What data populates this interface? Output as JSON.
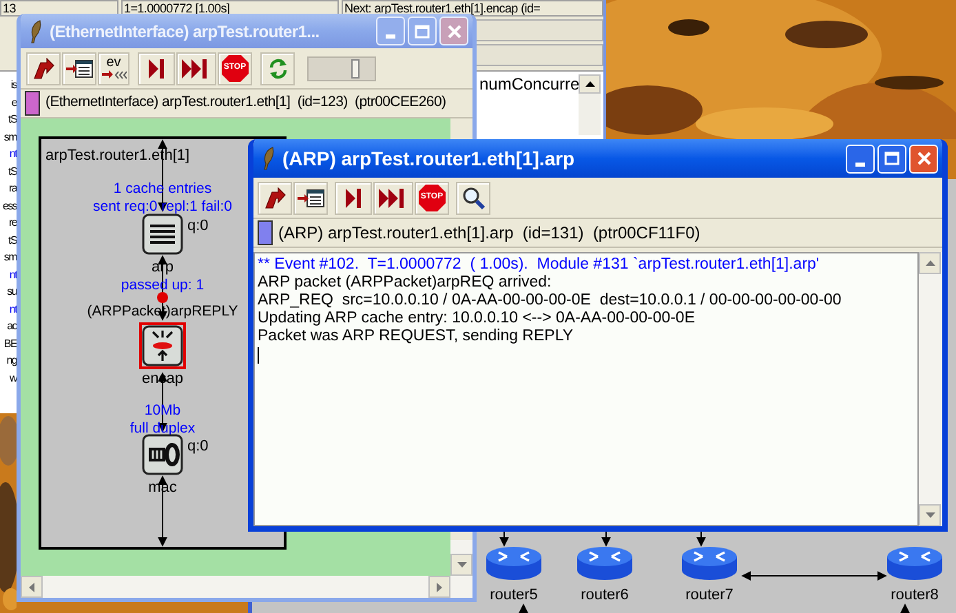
{
  "background_window": {
    "status_fields": [
      "13",
      "1=1.0000772 [1.00s]",
      "Next: arpTest.router1.eth[1].encap (id="
    ],
    "side_fragments": [
      {
        "text": "is",
        "kind": "plain"
      },
      {
        "text": "e",
        "kind": "plain"
      },
      {
        "text": "tS",
        "kind": "plain"
      },
      {
        "text": "sm",
        "kind": "plain"
      },
      {
        "text": "nt",
        "kind": "link"
      },
      {
        "text": "tS",
        "kind": "plain"
      },
      {
        "text": "ra",
        "kind": "plain"
      },
      {
        "text": "ess",
        "kind": "plain"
      },
      {
        "text": "re",
        "kind": "plain"
      },
      {
        "text": "tS",
        "kind": "plain"
      },
      {
        "text": "sm",
        "kind": "plain"
      },
      {
        "text": "nt",
        "kind": "link"
      },
      {
        "text": "su",
        "kind": "plain"
      },
      {
        "text": "nt",
        "kind": "link"
      },
      {
        "text": "ac",
        "kind": "plain"
      },
      {
        "text": "BE",
        "kind": "plain"
      },
      {
        "text": "ng",
        "kind": "plain"
      },
      {
        "text": "w",
        "kind": "plain"
      }
    ],
    "list_items": [
      "numConcurre"
    ]
  },
  "module_window": {
    "title": "(EthernetInterface) arpTest.router1...",
    "active": false,
    "toolbar": [
      {
        "kind": "parent"
      },
      {
        "kind": "network"
      },
      {
        "kind": "events",
        "label": "ev"
      },
      {
        "kind": "step"
      },
      {
        "kind": "run"
      },
      {
        "kind": "stop",
        "label": "STOP"
      },
      {
        "kind": "refresh"
      }
    ],
    "speed_slider": {
      "level": 0.7
    },
    "info": {
      "color": "#cc66cc",
      "text": "(EthernetInterface) arpTest.router1.eth[1]  (id=123)  (ptr00CEE260)"
    },
    "compound": {
      "label": "arpTest.router1.eth[1]",
      "modules": [
        {
          "kind": "arp",
          "label": "arp",
          "queue": "q:0",
          "info": [
            "1 cache entries",
            "sent req:0 repl:1 fail:0"
          ],
          "highlighted": false
        },
        {
          "kind": "encap",
          "label": "encap",
          "info": [
            "passed up: 1"
          ],
          "message": "(ARPPacket)arpREPLY",
          "highlighted": true
        },
        {
          "kind": "mac",
          "label": "mac",
          "queue": "q:0",
          "info": [
            "10Mb",
            "full duplex"
          ],
          "highlighted": false
        }
      ]
    }
  },
  "arp_window": {
    "title": "(ARP) arpTest.router1.eth[1].arp",
    "active": true,
    "toolbar": [
      {
        "kind": "parent"
      },
      {
        "kind": "network"
      },
      {
        "kind": "step"
      },
      {
        "kind": "run"
      },
      {
        "kind": "stop",
        "label": "STOP"
      },
      {
        "kind": "find"
      }
    ],
    "info": {
      "color": "#8080ee",
      "text": "(ARP) arpTest.router1.eth[1].arp  (id=131)  (ptr00CF11F0)"
    },
    "log_lines": [
      {
        "kind": "event",
        "text": "** Event #102.  T=1.0000772  ( 1.00s).  Module #131 `arpTest.router1.eth[1].arp'"
      },
      {
        "kind": "plain",
        "text": "ARP packet (ARPPacket)arpREQ arrived:"
      },
      {
        "kind": "plain",
        "text": "ARP_REQ  src=10.0.0.10 / 0A-AA-00-00-00-0E  dest=10.0.0.1 / 00-00-00-00-00-00"
      },
      {
        "kind": "plain",
        "text": "Updating ARP cache entry: 10.0.0.10 <--> 0A-AA-00-00-00-0E"
      },
      {
        "kind": "plain",
        "text": "Packet was ARP REQUEST, sending REPLY"
      }
    ]
  },
  "network": {
    "routers": [
      {
        "label": "router5"
      },
      {
        "label": "router6"
      },
      {
        "label": "router7"
      },
      {
        "label": "router8"
      }
    ]
  }
}
